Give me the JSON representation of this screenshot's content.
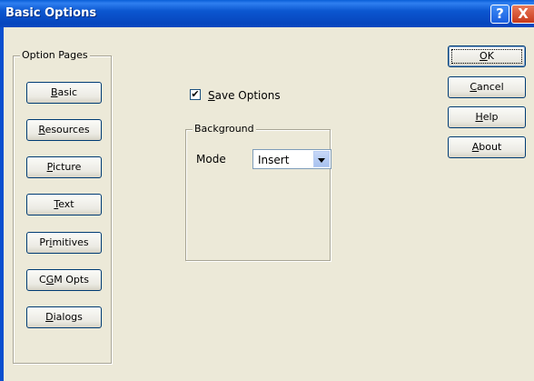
{
  "window": {
    "title": "Basic Options",
    "help_glyph": "?",
    "close_glyph": "X"
  },
  "option_pages": {
    "legend": "Option Pages",
    "buttons": [
      {
        "accel": "B",
        "rest": "asic"
      },
      {
        "accel": "R",
        "rest": "esources"
      },
      {
        "accel": "P",
        "rest": "icture"
      },
      {
        "accel": "T",
        "rest": "ext"
      },
      {
        "pre": "Pr",
        "accel": "i",
        "rest": "mitives"
      },
      {
        "pre": "C",
        "accel": "G",
        "rest": "M Opts"
      },
      {
        "accel": "D",
        "rest": "ialogs"
      }
    ]
  },
  "save_options": {
    "checked_glyph": "✔",
    "accel": "S",
    "rest": "ave Options"
  },
  "background": {
    "legend": "Background",
    "mode_label": "Mode",
    "mode_value": "Insert"
  },
  "actions": {
    "ok": {
      "accel": "O",
      "rest": "K"
    },
    "cancel": {
      "accel": "C",
      "rest": "ancel"
    },
    "help": {
      "accel": "H",
      "rest": "elp"
    },
    "about": {
      "accel": "A",
      "rest": "bout"
    }
  }
}
